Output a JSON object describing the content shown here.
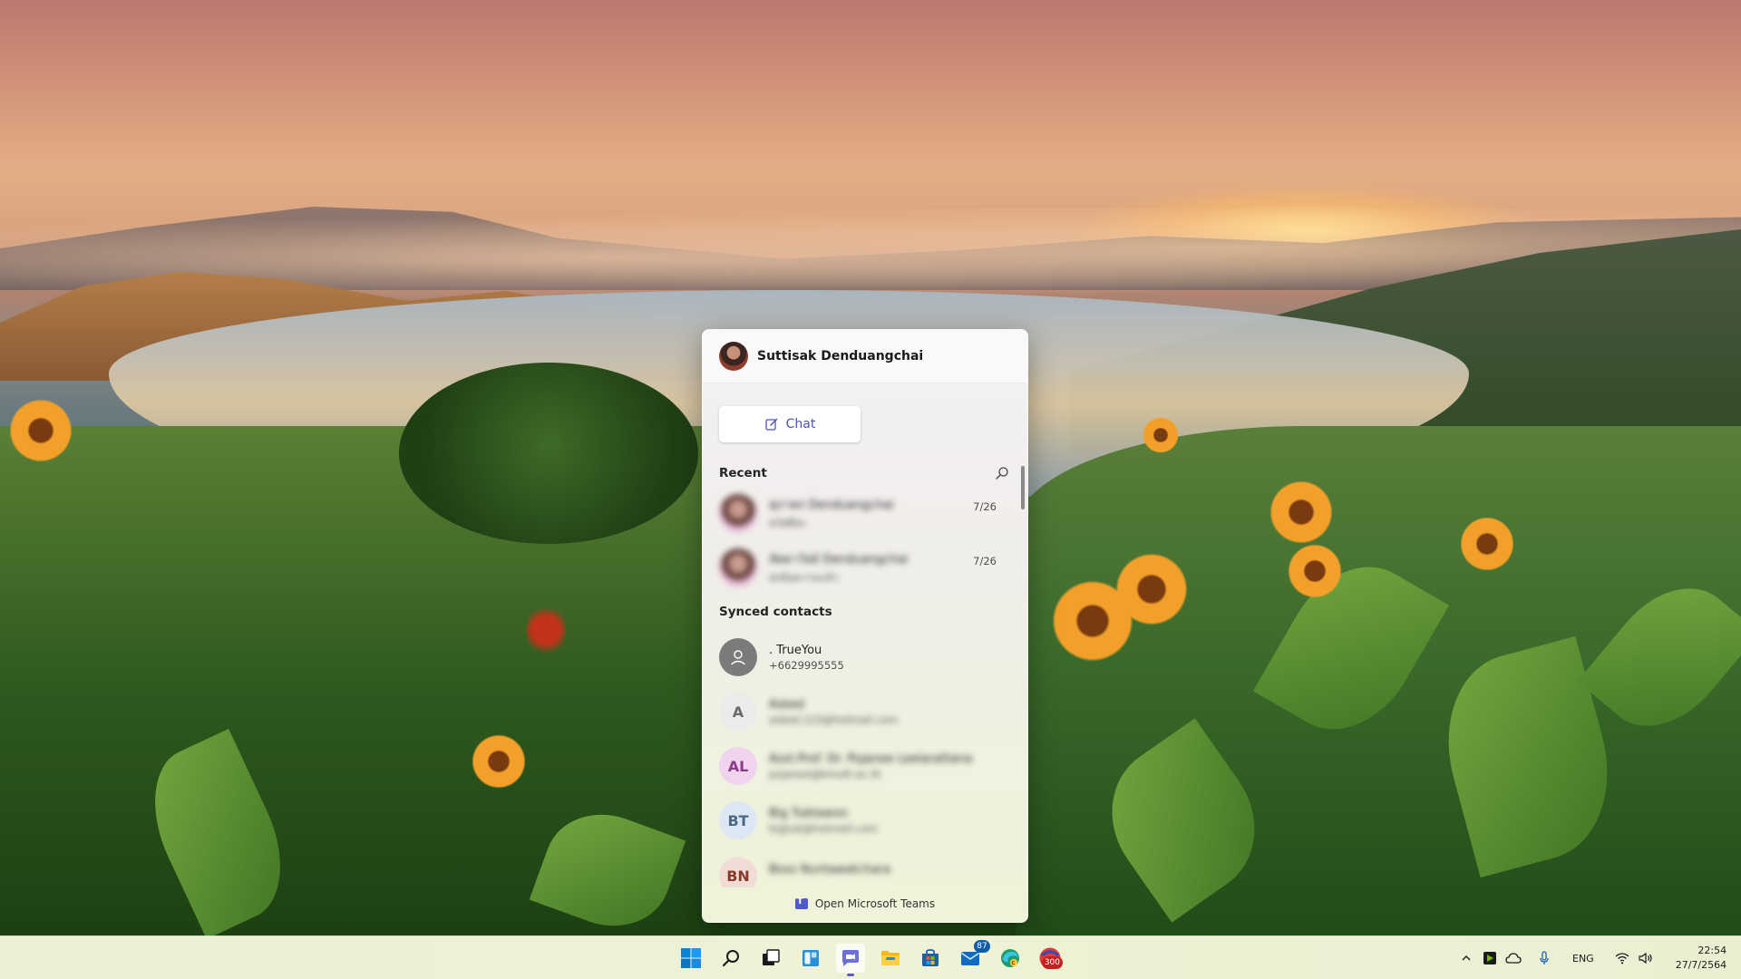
{
  "flyout": {
    "user_name": "Suttisak Denduangchai",
    "chat_button_label": "Chat",
    "recent_label": "Recent",
    "recent": [
      {
        "name": "สุภาพร Denduangchai",
        "preview": "สวัสดีค่ะ",
        "date": "7/26"
      },
      {
        "name": "ลัดดาวัลย์ Denduangchai",
        "preview": "ส่งข้อความแล้ว",
        "date": "7/26"
      }
    ],
    "synced_label": "Synced contacts",
    "contacts": [
      {
        "initials": "",
        "name": ". TrueYou",
        "detail": "+6629995555",
        "blurred": false
      },
      {
        "initials": "A",
        "name": "Asked",
        "detail": "asked.123@hotmail.com",
        "blurred": true
      },
      {
        "initials": "AL",
        "name": "Asst.Prof. Dr. Pojanee Leelarattana",
        "detail": "pojanee@kmutt.ac.th",
        "blurred": true
      },
      {
        "initials": "BT",
        "name": "Big Tubtawon",
        "detail": "bigtub@hotmail.com",
        "blurred": true
      },
      {
        "initials": "BN",
        "name": "Boss Nuntawatchara",
        "detail": "",
        "blurred": true
      }
    ],
    "footer_label": "Open Microsoft Teams"
  },
  "taskbar": {
    "apps": [
      {
        "name": "start",
        "icon": "windows-logo-icon"
      },
      {
        "name": "search",
        "icon": "search-icon"
      },
      {
        "name": "task-view",
        "icon": "task-view-icon"
      },
      {
        "name": "widgets",
        "icon": "widgets-icon"
      },
      {
        "name": "chat",
        "icon": "chat-icon"
      },
      {
        "name": "file-explorer",
        "icon": "folder-icon"
      },
      {
        "name": "store",
        "icon": "store-icon"
      },
      {
        "name": "mail",
        "icon": "mail-icon",
        "badge": "87"
      },
      {
        "name": "edge",
        "icon": "edge-icon"
      },
      {
        "name": "counter-app",
        "icon": "red-app-icon",
        "badge": "300"
      }
    ],
    "tray": {
      "language": "ENG",
      "time": "22:54",
      "date": "27/7/2564"
    }
  },
  "colors": {
    "accent": "#5b5fc7",
    "teams": "#5059c9"
  }
}
